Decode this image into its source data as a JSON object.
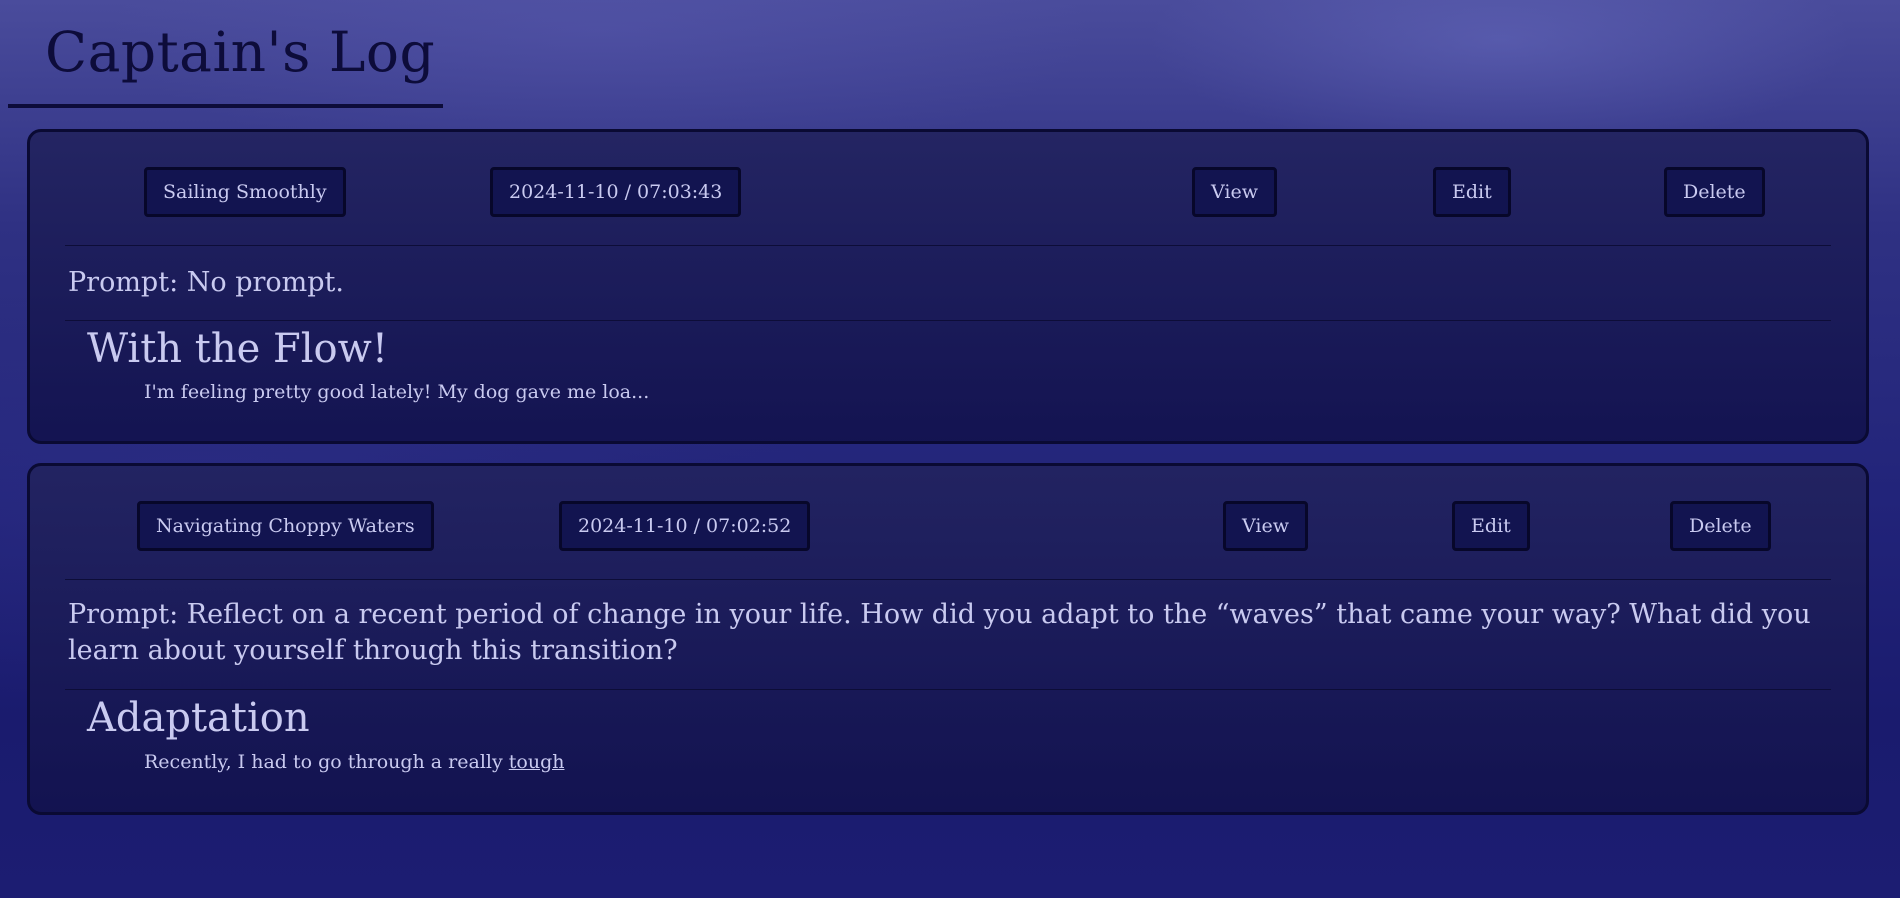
{
  "app": {
    "title": "Captain's Log"
  },
  "entries": [
    {
      "mood": "Sailing Smoothly",
      "timestamp": "2024-11-10 / 07:03:43",
      "view_label": "View",
      "edit_label": "Edit",
      "delete_label": "Delete",
      "prompt": "Prompt: No prompt.",
      "title": "With the Flow!",
      "excerpt": "I'm feeling pretty good lately! My dog gave me loa..."
    },
    {
      "mood": "Navigating Choppy Waters",
      "timestamp": "2024-11-10 / 07:02:52",
      "view_label": "View",
      "edit_label": "Edit",
      "delete_label": "Delete",
      "prompt": "Prompt: Reflect on a recent period of change in your life. How did you adapt to the “waves” that came your way? What did you learn about yourself through this transition?",
      "title": "Adaptation",
      "excerpt": "Recently, I had to go through a really ",
      "excerpt_link": "tough"
    }
  ],
  "colors": {
    "background_top": "#4a4c9c",
    "background_bottom": "#1c1d72",
    "title": "#0d0c3a",
    "text": "#c9caf0",
    "button_bg": "#121450",
    "border": "#07072a"
  }
}
